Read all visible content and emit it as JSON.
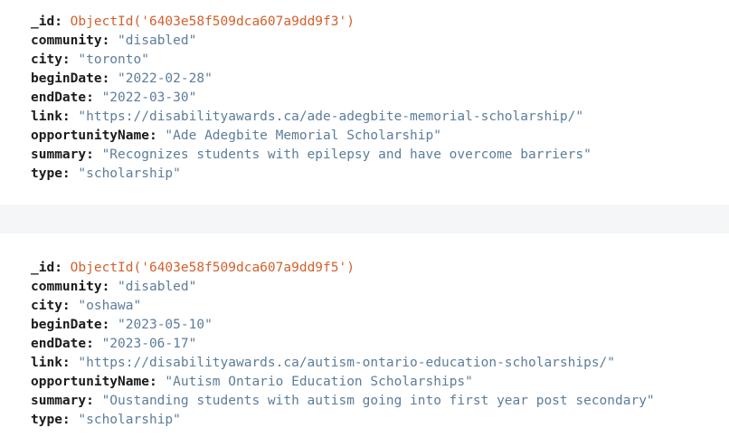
{
  "documents": [
    {
      "fields": [
        {
          "key": "_id",
          "value": "ObjectId('6403e58f509dca607a9dd9f3')",
          "kind": "objectid"
        },
        {
          "key": "community",
          "value": "\"disabled\"",
          "kind": "string"
        },
        {
          "key": "city",
          "value": "\"toronto\"",
          "kind": "string"
        },
        {
          "key": "beginDate",
          "value": "\"2022-02-28\"",
          "kind": "string"
        },
        {
          "key": "endDate",
          "value": "\"2022-03-30\"",
          "kind": "string"
        },
        {
          "key": "link",
          "value": "\"https://disabilityawards.ca/ade-adegbite-memorial-scholarship/\"",
          "kind": "string"
        },
        {
          "key": "opportunityName",
          "value": "\"Ade Adegbite Memorial Scholarship\"",
          "kind": "string"
        },
        {
          "key": "summary",
          "value": "\"Recognizes students with epilepsy and have overcome barriers\"",
          "kind": "string"
        },
        {
          "key": "type",
          "value": "\"scholarship\"",
          "kind": "string"
        }
      ]
    },
    {
      "fields": [
        {
          "key": "_id",
          "value": "ObjectId('6403e58f509dca607a9dd9f5')",
          "kind": "objectid"
        },
        {
          "key": "community",
          "value": "\"disabled\"",
          "kind": "string"
        },
        {
          "key": "city",
          "value": "\"oshawa\"",
          "kind": "string"
        },
        {
          "key": "beginDate",
          "value": "\"2023-05-10\"",
          "kind": "string"
        },
        {
          "key": "endDate",
          "value": "\"2023-06-17\"",
          "kind": "string"
        },
        {
          "key": "link",
          "value": "\"https://disabilityawards.ca/autism-ontario-education-scholarships/\"",
          "kind": "string"
        },
        {
          "key": "opportunityName",
          "value": "\"Autism Ontario Education Scholarships\"",
          "kind": "string"
        },
        {
          "key": "summary",
          "value": "\"Oustanding students with autism going into first year post secondary\"",
          "kind": "string"
        },
        {
          "key": "type",
          "value": "\"scholarship\"",
          "kind": "string"
        }
      ]
    }
  ],
  "colors": {
    "key": "#1b1b1b",
    "string_value": "#5d7d9a",
    "objectid_value": "#d3602e",
    "separator": "#f5f6f7"
  }
}
